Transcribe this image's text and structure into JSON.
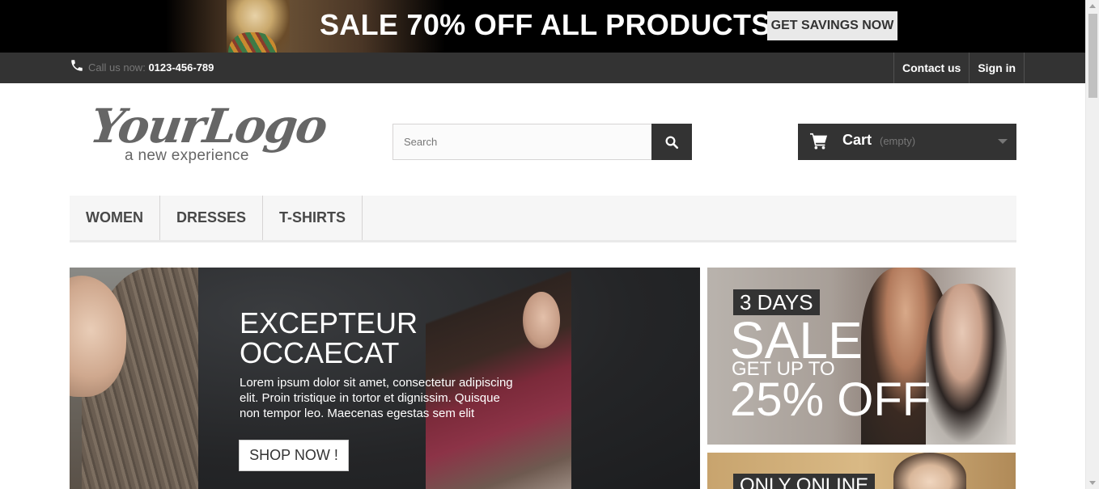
{
  "promo": {
    "headline": "SALE 70% OFF ALL PRODUCTS",
    "button_label": "GET SAVINGS NOW"
  },
  "topbar": {
    "call_label": "Call us now:",
    "phone": "0123-456-789",
    "contact_label": "Contact us",
    "signin_label": "Sign in"
  },
  "header": {
    "logo_script": "YourLogo",
    "logo_tagline": "a new experience",
    "search_placeholder": "Search",
    "search_value": "",
    "cart_label": "Cart",
    "cart_status": "(empty)"
  },
  "menu": {
    "items": [
      {
        "label": "WOMEN"
      },
      {
        "label": "DRESSES"
      },
      {
        "label": "T-SHIRTS"
      }
    ]
  },
  "hero": {
    "title": "EXCEPTEUR OCCAECAT",
    "text": "Lorem ipsum dolor sit amet, consectetur adipiscing elit. Proin tristique in tortor et dignissim. Quisque non tempor leo. Maecenas egestas sem elit",
    "button_label": "SHOP NOW !"
  },
  "banners": {
    "first": {
      "days": "3 DAYS",
      "sale": "SALE",
      "get_up_to": "GET UP TO",
      "discount": "25% OFF"
    },
    "second": {
      "label": "ONLY ONLINE"
    }
  },
  "colors": {
    "dark": "#333333",
    "menu_bg": "#f6f6f6",
    "promo_bg": "#000000"
  },
  "icons": {
    "phone": "phone-icon",
    "search": "search-icon",
    "cart": "cart-icon",
    "caret": "chevron-down-icon"
  }
}
